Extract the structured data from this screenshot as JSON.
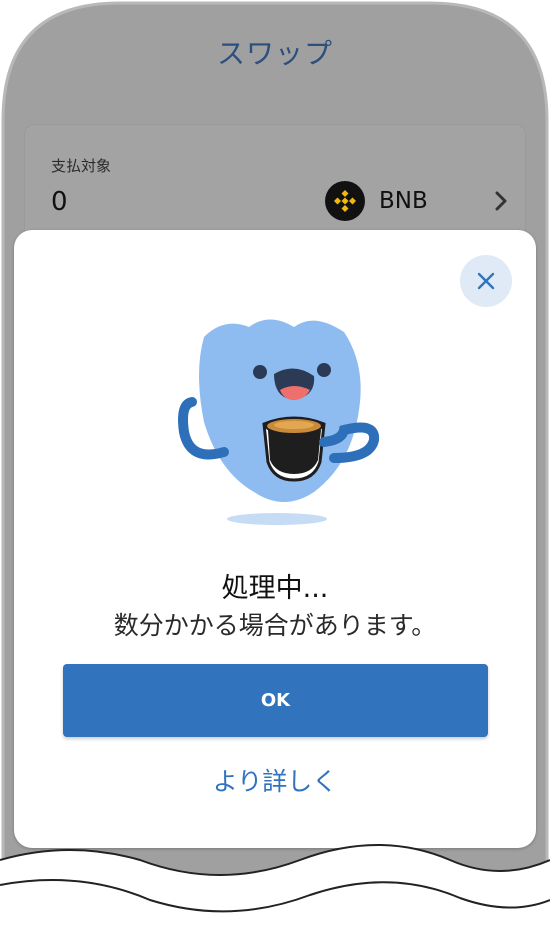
{
  "header": {
    "title": "スワップ"
  },
  "pay": {
    "label": "支払対象",
    "amount": "0",
    "token_symbol": "BNB",
    "token_icon": "bnb-coin-icon",
    "token_color": "#f0b90b"
  },
  "modal": {
    "title": "処理中...",
    "subtitle": "数分かかる場合があります。",
    "ok_label": "OK",
    "more_label": "より詳しく",
    "close_icon": "close-icon",
    "illustration": "mascot-with-coffee-cup"
  },
  "colors": {
    "accent": "#3174bd",
    "title_text": "#2c4f7e",
    "overlay": "#a0a0a0",
    "mascot_blue": "#8fbcf0",
    "close_bg": "#dfeaf6"
  }
}
